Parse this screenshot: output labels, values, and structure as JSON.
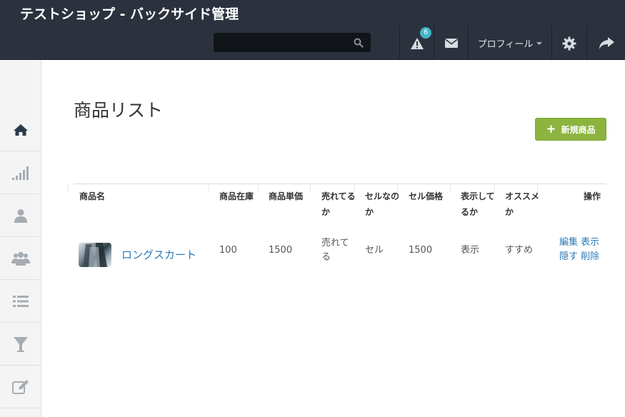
{
  "header": {
    "title": "テストショップ - バックサイド管理",
    "search": {
      "value": "",
      "placeholder": ""
    },
    "alerts_count": "6",
    "profile_label": "プロフィール"
  },
  "sidebar": {
    "items": [
      {
        "icon": "home-icon"
      },
      {
        "icon": "signal-icon"
      },
      {
        "icon": "user-icon"
      },
      {
        "icon": "users-icon"
      },
      {
        "icon": "list-icon"
      },
      {
        "icon": "filter-icon"
      },
      {
        "icon": "edit-icon"
      }
    ]
  },
  "main": {
    "title": "商品リスト",
    "new_button_label": "新規商品",
    "table": {
      "headers": {
        "name": "商品名",
        "stock": "商品在庫",
        "price": "商品単価",
        "selling": [
          "売れてる",
          "か"
        ],
        "sale": [
          "セルなの",
          "か"
        ],
        "sale_price": "セル価格",
        "visible": [
          "表示して",
          "るか"
        ],
        "recommend": [
          "オススメ",
          "か"
        ],
        "actions": "操作"
      },
      "rows": [
        {
          "name": "ロングスカート",
          "stock": "100",
          "price": "1500",
          "selling": [
            "売れて",
            "る"
          ],
          "sale": "セル",
          "sale_price": "1500",
          "visible": "表示",
          "recommend": "すすめ",
          "actions": {
            "edit": "編集",
            "show": "表示",
            "hide": "隠す",
            "delete": "削除"
          }
        }
      ]
    }
  },
  "colors": {
    "topbar": "#2b323d",
    "accent_green": "#8cb43f",
    "link": "#2a7ab8",
    "badge": "#41b6c8"
  }
}
